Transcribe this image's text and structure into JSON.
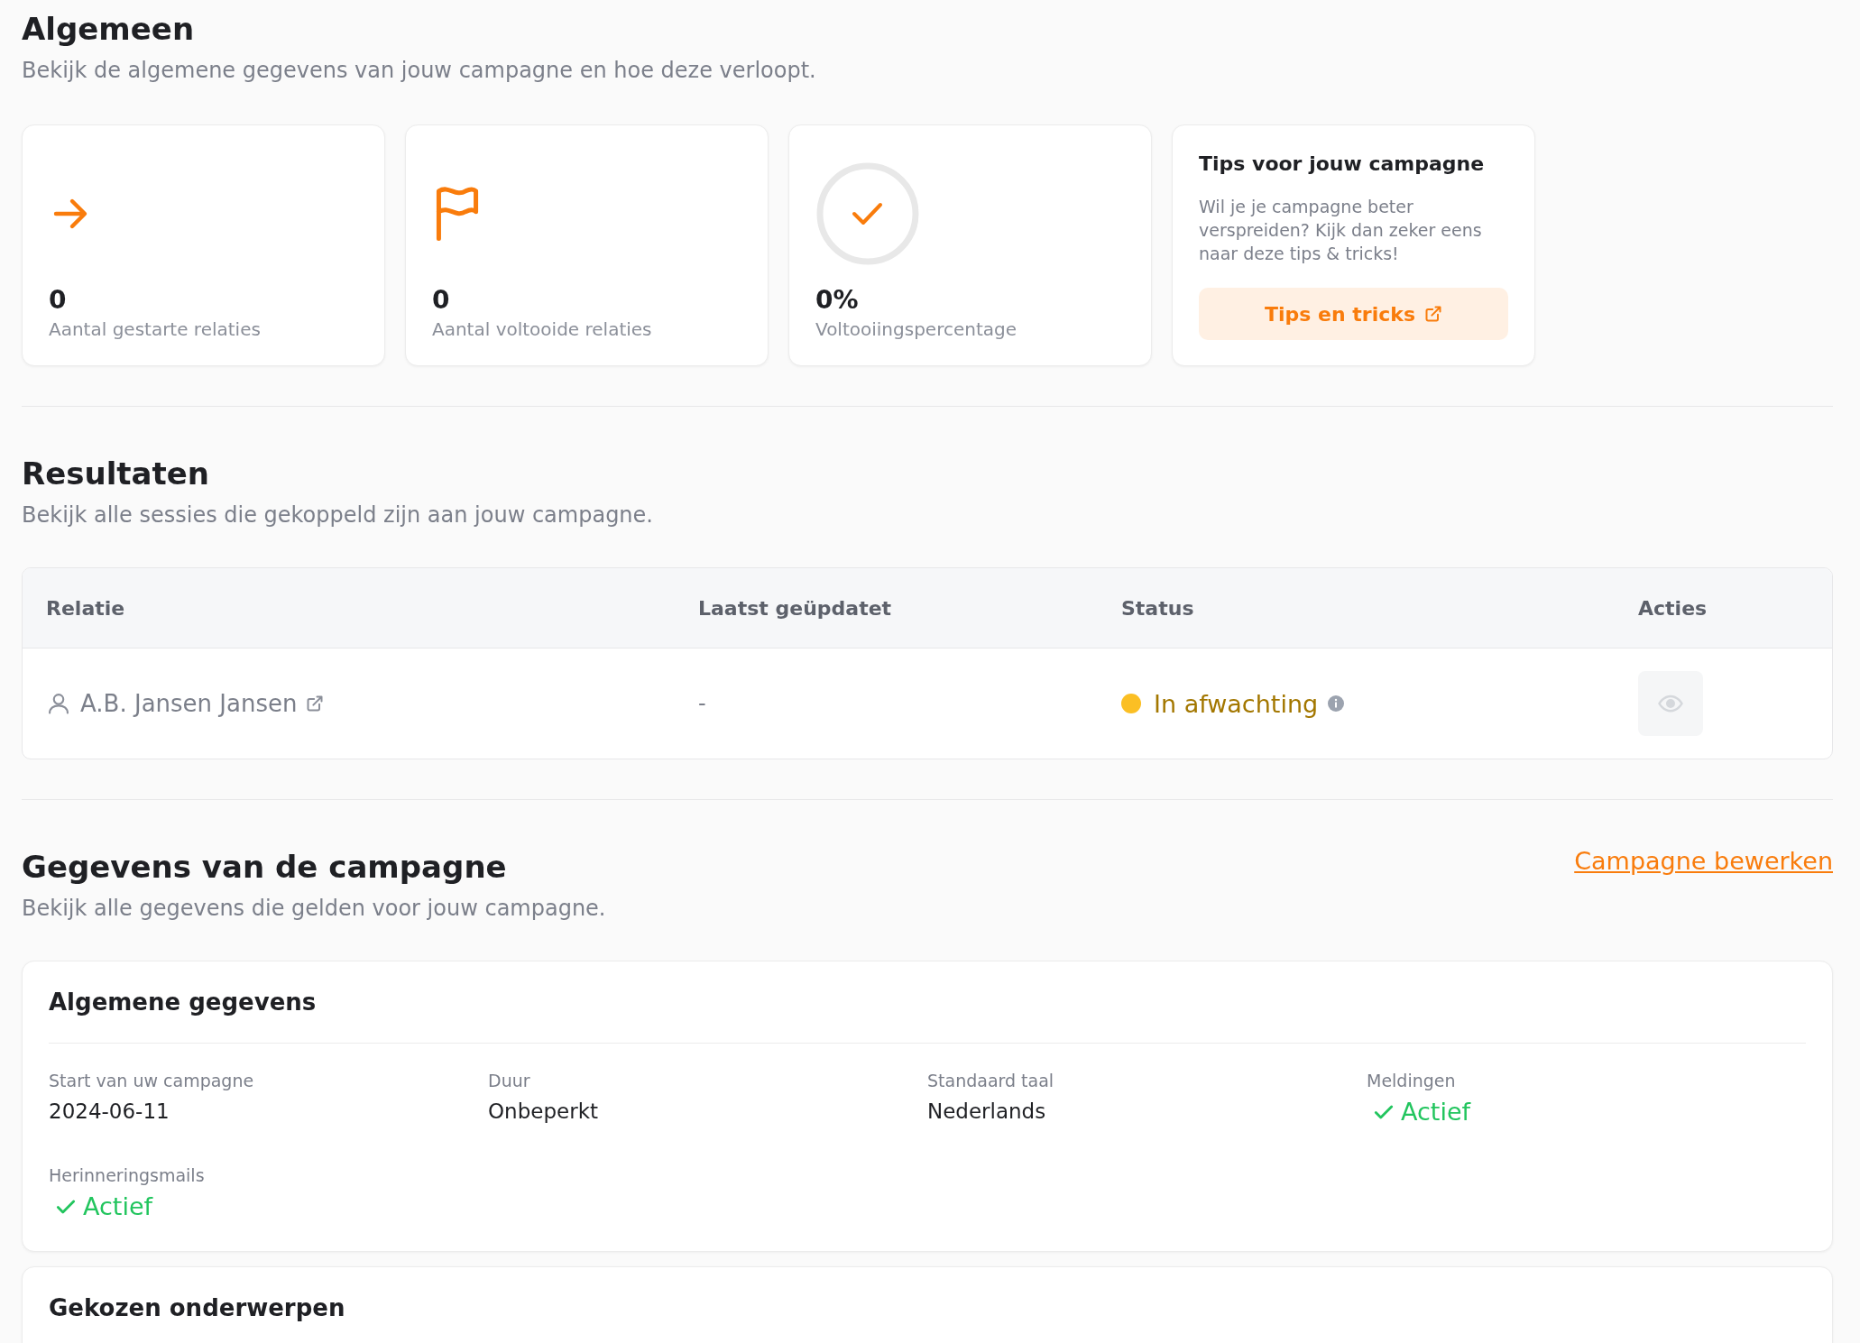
{
  "general": {
    "title": "Algemeen",
    "subtitle": "Bekijk de algemene gegevens van jouw campagne en hoe deze verloopt.",
    "stats": [
      {
        "kind": "arrow",
        "value": "0",
        "label": "Aantal gestarte relaties"
      },
      {
        "kind": "flag",
        "value": "0",
        "label": "Aantal voltooide relaties"
      },
      {
        "kind": "ring",
        "value": "0%",
        "label": "Voltooiingspercentage"
      }
    ],
    "tips": {
      "title": "Tips voor jouw campagne",
      "text": "Wil je je campagne beter verspreiden? Kijk dan zeker eens naar deze tips & tricks!",
      "button": "Tips en tricks"
    }
  },
  "results": {
    "title": "Resultaten",
    "subtitle": "Bekijk alle sessies die gekoppeld zijn aan jouw campagne.",
    "table": {
      "columns": [
        "Relatie",
        "Laatst geüpdatet",
        "Status",
        "Acties"
      ],
      "rows": [
        {
          "relation": "A.B. Jansen Jansen",
          "updated": "-",
          "status": "In afwachting",
          "color": "#fbbf24"
        }
      ]
    }
  },
  "campaign": {
    "title": "Gegevens van de campagne",
    "subtitle": "Bekijk alle gegevens die gelden voor jouw campagne.",
    "edit_link": "Campagne bewerken",
    "sections": [
      {
        "title": "Algemene gegevens",
        "fields": [
          {
            "label": "Start van uw campagne",
            "value": "2024-06-11",
            "kind": "text"
          },
          {
            "label": "Duur",
            "value": "Onbeperkt",
            "kind": "text"
          },
          {
            "label": "Standaard taal",
            "value": "Nederlands",
            "kind": "text"
          },
          {
            "label": "Meldingen",
            "value": "Actief",
            "kind": "check"
          },
          {
            "label": "Herinneringsmails",
            "value": "Actief",
            "kind": "check"
          }
        ]
      },
      {
        "title": "Gekozen onderwerpen"
      }
    ]
  }
}
